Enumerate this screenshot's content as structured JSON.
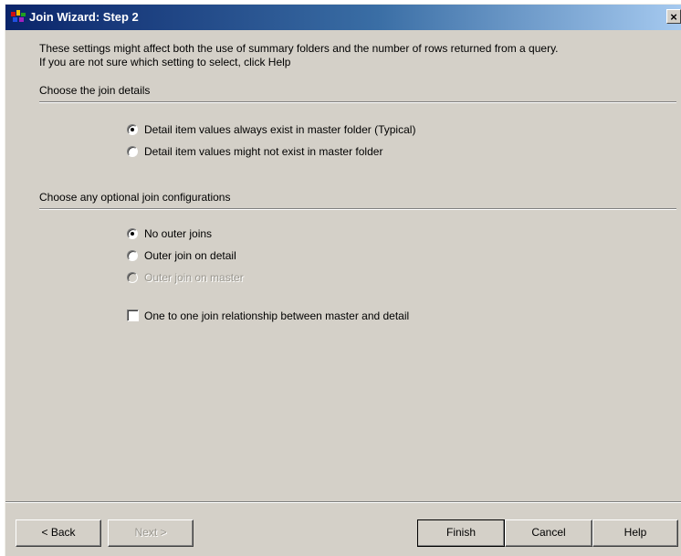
{
  "window": {
    "title": "Join Wizard: Step 2",
    "close_symbol": "×",
    "icon": "wizard-app-icon"
  },
  "intro": {
    "line1": "These settings might affect both the use of summary folders and the number of rows returned from a query.",
    "line2": "If you are not sure which setting to select, click Help"
  },
  "join_details": {
    "heading": "Choose the join details",
    "options": [
      {
        "label": "Detail item values always exist in master folder (Typical)",
        "selected": true
      },
      {
        "label": "Detail item values might not exist in master folder",
        "selected": false
      }
    ]
  },
  "join_config": {
    "heading": "Choose any optional join configurations",
    "options": [
      {
        "label": "No outer joins",
        "selected": true,
        "enabled": true
      },
      {
        "label": "Outer join on detail",
        "selected": false,
        "enabled": true
      },
      {
        "label": "Outer join on master",
        "selected": false,
        "enabled": false
      }
    ],
    "checkbox": {
      "label": "One to one join relationship between master and detail",
      "checked": false
    }
  },
  "buttons": {
    "back": "< Back",
    "next": "Next >",
    "finish": "Finish",
    "cancel": "Cancel",
    "help": "Help"
  }
}
